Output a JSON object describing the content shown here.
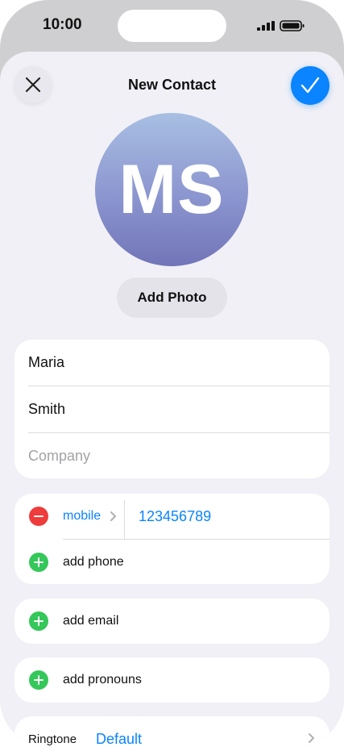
{
  "status_bar": {
    "time": "10:00"
  },
  "header": {
    "title": "New Contact"
  },
  "avatar": {
    "initials": "MS"
  },
  "add_photo_label": "Add Photo",
  "name_card": {
    "first_name": "Maria",
    "last_name": "Smith",
    "company_placeholder": "Company"
  },
  "phone_card": {
    "label": "mobile",
    "number": "123456789",
    "add_label": "add phone"
  },
  "email_card": {
    "add_label": "add email"
  },
  "pronouns_card": {
    "add_label": "add pronouns"
  },
  "ringtone_card": {
    "label": "Ringtone",
    "value": "Default"
  },
  "colors": {
    "accent": "#0a84ff",
    "add_green": "#34c759",
    "remove_red": "#ee3b3b"
  }
}
